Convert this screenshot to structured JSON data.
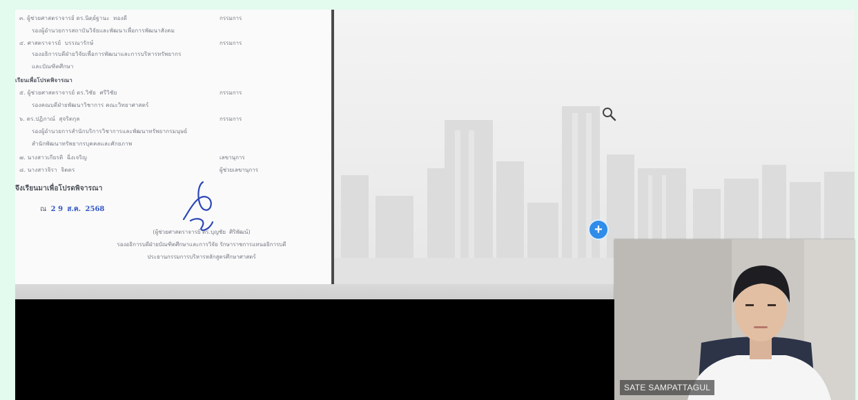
{
  "meeting": {
    "participant_name": "SATE SAMPATTAGUL",
    "pin_symbol": "+"
  },
  "document": {
    "signature_date": {
      "prefix": "ณ",
      "day": "2 9",
      "month": "ส.ค.",
      "year": "2568"
    },
    "section_heading": "จึงเรียนมาเพื่อโปรดพิจารณา"
  },
  "colors": {
    "accent": "#2f8ce8",
    "background": "#e3faee",
    "screen": "#000000"
  },
  "icons": {
    "zoom": "magnifier-icon",
    "pin": "plus-circle-icon"
  }
}
